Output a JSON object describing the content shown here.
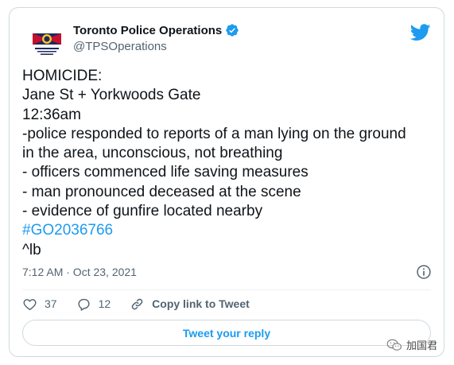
{
  "author": {
    "display_name": "Toronto Police Operations",
    "handle": "@TPSOperations",
    "verified": true
  },
  "tweet": {
    "lines": [
      "HOMICIDE:",
      "Jane St + Yorkwoods Gate",
      "12:36am",
      "-police responded to reports of a man lying on the ground",
      "in the area, unconscious, not breathing",
      "- officers commenced life saving measures",
      "- man pronounced deceased at the scene",
      "- evidence of gunfire located nearby"
    ],
    "hashtag": "#GO2036766",
    "signature": "^lb"
  },
  "timestamp": "7:12 AM · Oct 23, 2021",
  "actions": {
    "likes": "37",
    "replies": "12",
    "copy_link_label": "Copy link to Tweet"
  },
  "reply_button_label": "Tweet your reply",
  "watermark_text": "加国君",
  "icons": {
    "brand": "twitter-bird-icon",
    "verified": "verified-badge-icon",
    "info": "info-icon",
    "like": "heart-icon",
    "reply": "reply-bubble-icon",
    "copy": "link-icon"
  },
  "colors": {
    "accent": "#1d9bf0",
    "text": "#0f1419",
    "secondary": "#536471",
    "border": "#cfd9de"
  }
}
